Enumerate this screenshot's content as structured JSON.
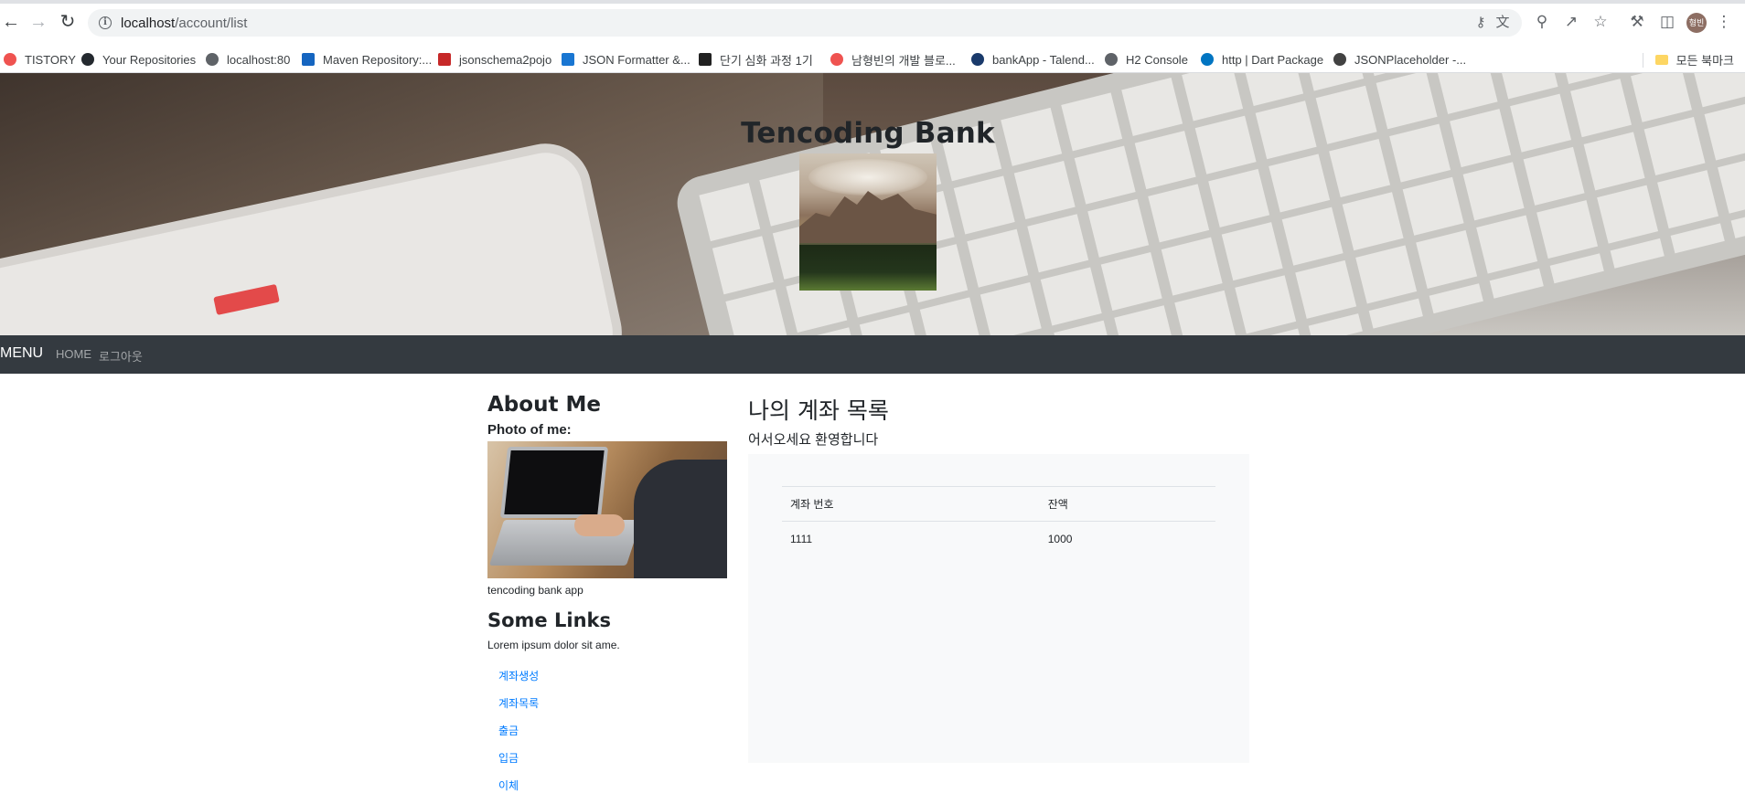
{
  "browser": {
    "url_host": "localhost",
    "url_path": "/account/list",
    "avatar_text": "형빈",
    "icons": [
      "back-icon",
      "forward-icon",
      "reload-icon",
      "info-icon",
      "key-icon",
      "translate-icon",
      "zoom-icon",
      "share-icon",
      "star-icon",
      "extensions-icon",
      "sidepanel-icon",
      "menu-icon"
    ]
  },
  "bookmarks": [
    {
      "label": "TISTORY",
      "color": "#ef5350"
    },
    {
      "label": "Your Repositories",
      "color": "#24292f"
    },
    {
      "label": "localhost:80",
      "color": "#5f6368"
    },
    {
      "label": "Maven Repository:...",
      "color": "#1565c0"
    },
    {
      "label": "jsonschema2pojo",
      "color": "#c62828"
    },
    {
      "label": "JSON Formatter &...",
      "color": "#1976d2"
    },
    {
      "label": "단기 심화 과정 1기",
      "color": "#212121"
    },
    {
      "label": "남형빈의 개발 블로...",
      "color": "#ef5350"
    },
    {
      "label": "bankApp - Talend...",
      "color": "#1a3a6b"
    },
    {
      "label": "H2 Console",
      "color": "#5f6368"
    },
    {
      "label": "http | Dart Package",
      "color": "#0175c2"
    },
    {
      "label": "JSONPlaceholder -...",
      "color": "#424242"
    }
  ],
  "bookmarks_folder": "모든 북마크",
  "hero": {
    "title": "Tencoding Bank"
  },
  "navbar": {
    "brand": "MENU",
    "links": [
      "HOME",
      "로그아웃"
    ]
  },
  "sidebar": {
    "about_title": "About Me",
    "photo_label": "Photo of me:",
    "caption": "tencoding bank app",
    "links_title": "Some Links",
    "lorem": "Lorem ipsum dolor sit ame.",
    "links": [
      "계좌생성",
      "계좌목록",
      "출금",
      "입금",
      "이체"
    ]
  },
  "main": {
    "title": "나의 계좌 목록",
    "welcome": "어서오세요 환영합니다",
    "table": {
      "headers": [
        "계좌 번호",
        "잔액"
      ],
      "rows": [
        [
          "1111",
          "1000"
        ]
      ]
    }
  }
}
